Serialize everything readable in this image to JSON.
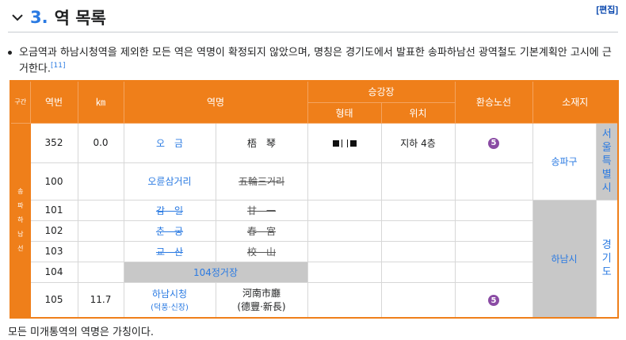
{
  "heading": {
    "number": "3.",
    "title": "역 목록",
    "edit_label": "[편집]"
  },
  "paragraph": {
    "text": "오금역과 하남시청역을 제외한 모든 역은 역명이 확정되지 않았으며, 명칭은 경기도에서 발표한 송파하남선 광역철도 기본계획안 고시에 근거한다.",
    "ref": "[11]"
  },
  "table": {
    "headers": {
      "section": "구간",
      "station_no": "역번",
      "km": "㎞",
      "station_name": "역명",
      "platform": "승강장",
      "platform_type": "형태",
      "platform_location": "위치",
      "transfer": "환승노선",
      "location": "소재지"
    },
    "line_name_chars": [
      "송",
      "파",
      "하",
      "남",
      "선"
    ],
    "rows": [
      {
        "no": "352",
        "km": "0.0",
        "name_ko": "오　금",
        "name_hanja": "梧　琴",
        "platform_location": "지하 4층",
        "transfer_badge": "5"
      },
      {
        "no": "100",
        "km": "",
        "name_ko": "오륜삼거리",
        "name_hanja": "五輪三거리"
      },
      {
        "no": "101",
        "km": "",
        "name_ko": "감　일",
        "name_hanja": "甘　一"
      },
      {
        "no": "102",
        "km": "",
        "name_ko": "춘　궁",
        "name_hanja": "春　宮"
      },
      {
        "no": "103",
        "km": "",
        "name_ko": "교　산",
        "name_hanja": "校　山"
      },
      {
        "no": "104",
        "km": "",
        "name_ko": "104정거장"
      },
      {
        "no": "105",
        "km": "11.7",
        "name_ko": "하남시청",
        "name_ko_sub": "(덕풍·신장)",
        "name_hanja": "河南市廳",
        "name_hanja_sub": "(德豐·新長)",
        "transfer_badge": "5"
      }
    ],
    "districts": {
      "songpa": "송파구",
      "hanam": "하남시"
    },
    "provinces": {
      "seoul_chars": [
        "서",
        "울",
        "특",
        "별",
        "시"
      ],
      "gyeonggi_chars": [
        "경",
        "기",
        "도"
      ]
    }
  },
  "footer": "모든 미개통역의 역명은 가칭이다.",
  "colors": {
    "header_orange": "#ef7f1a",
    "line5_purple": "#8a4ba4",
    "link_blue": "#2a7ae2",
    "grey_fill": "#c8c8c8"
  }
}
